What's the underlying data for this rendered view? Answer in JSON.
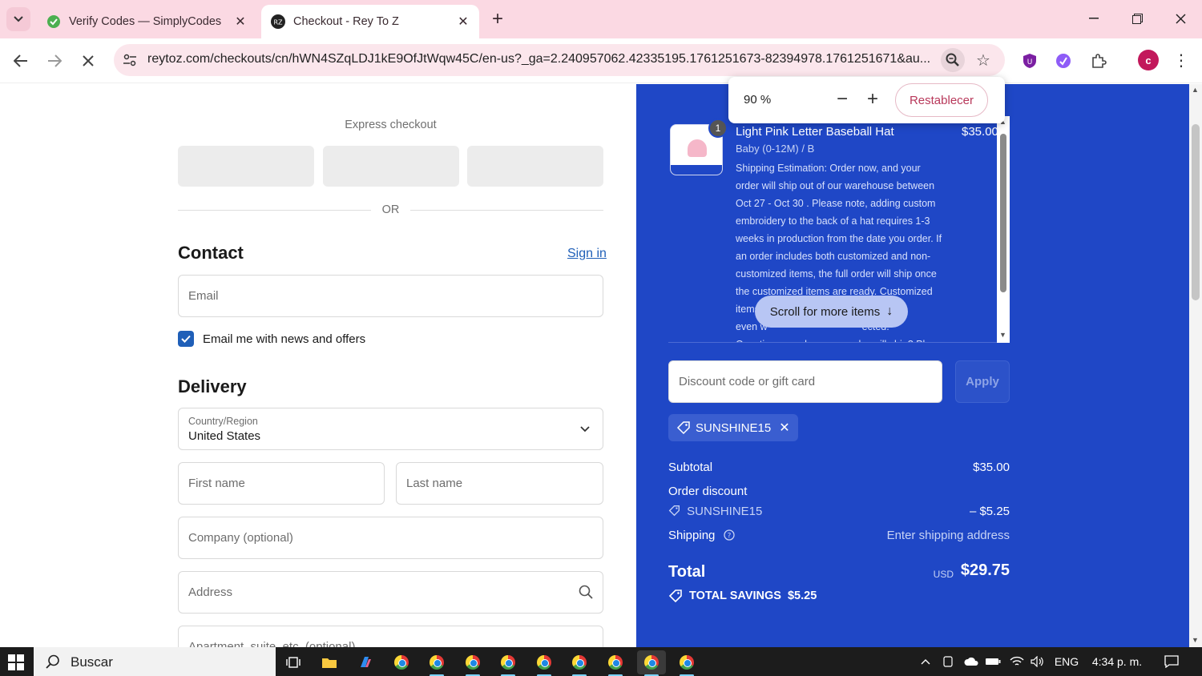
{
  "browser": {
    "tabs": [
      {
        "title": "Verify Codes — SimplyCodes",
        "active": false
      },
      {
        "title": "Checkout - Rey To Z",
        "active": true
      }
    ],
    "url": "reytoz.com/checkouts/cn/hWN4SZqLDJ1kE9OfJtWqw45C/en-us?_ga=2.240957062.42335195.1761251673-82394978.1761251671&au...",
    "zoom_popup": {
      "value": "90 %",
      "reset_label": "Restablecer"
    },
    "profile_initial": "c",
    "accent_color": "#fbd9e3"
  },
  "checkout": {
    "express_title": "Express checkout",
    "or_label": "OR",
    "contact": {
      "heading": "Contact",
      "sign_in": "Sign in",
      "email_placeholder": "Email",
      "news_label": "Email me with news and offers",
      "news_checked": true
    },
    "delivery": {
      "heading": "Delivery",
      "country_label": "Country/Region",
      "country_value": "United States",
      "first_name_placeholder": "First name",
      "last_name_placeholder": "Last name",
      "company_placeholder": "Company (optional)",
      "address_placeholder": "Address",
      "apartment_placeholder": "Apartment, suite, etc. (optional)"
    }
  },
  "summary": {
    "background_color": "#1f47c6",
    "item": {
      "quantity": "1",
      "name": "Light Pink Letter Baseball Hat",
      "price": "$35.00",
      "variant": "Baby (0-12M) / B",
      "description_lines": [
        "Shipping Estimation: Order now, and your",
        "order will ship out of our warehouse between",
        "Oct 27 - Oct 30 . Please note, adding custom",
        "embroidery to the back of a hat requires 1-3",
        "weeks in production from the date you order. If",
        "an order includes both customized and non-",
        "customized items, the full order will ship once",
        "the customized items are ready. Customized",
        "items                                    oduce,",
        "even w                                  ected.",
        "Questions on when your order will ship? Please"
      ]
    },
    "scroll_more_label": "Scroll for more items",
    "discount_placeholder": "Discount code or gift card",
    "apply_label": "Apply",
    "applied_code": "SUNSHINE15",
    "subtotal_label": "Subtotal",
    "subtotal_value": "$35.00",
    "order_discount_label": "Order discount",
    "discount_code": "SUNSHINE15",
    "discount_value": "– $5.25",
    "shipping_label": "Shipping",
    "shipping_value": "Enter shipping address",
    "total_label": "Total",
    "total_currency": "USD",
    "total_value": "$29.75",
    "savings_label": "TOTAL SAVINGS  $5.25"
  },
  "taskbar": {
    "search_label": "Buscar",
    "language": "ENG",
    "time": "4:34 p. m."
  }
}
